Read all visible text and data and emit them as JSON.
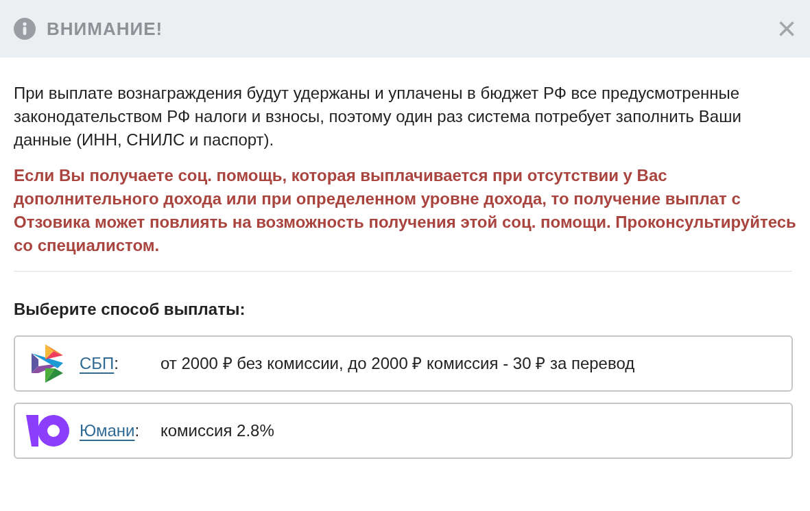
{
  "dialog": {
    "title": "ВНИМАНИЕ!",
    "close": "×"
  },
  "notice": "При выплате вознаграждения будут удержаны и уплачены в бюджет РФ все предусмотренные законодательством РФ налоги и взносы, поэтому один раз система потребует заполнить Ваши данные (ИНН, СНИЛС и паспорт).",
  "warning": "Если Вы получаете соц. помощь, которая выплачивается при отсутствии у Вас дополнительного дохода или при определенном уровне дохода, то получение выплат с Отзовика может повлиять на возможность получения этой соц. помощи. Проконсультируйтесь со специалистом.",
  "methods_heading": "Выберите способ выплаты:",
  "methods": [
    {
      "kind": "sbp",
      "name": "СБП",
      "suffix": ":",
      "description": "от 2000 ₽ без комиссии, до 2000 ₽ комиссия - 30 ₽ за перевод"
    },
    {
      "kind": "yoomoney",
      "name": "Юмани",
      "suffix": ":",
      "description": "комиссия 2.8%"
    }
  ]
}
